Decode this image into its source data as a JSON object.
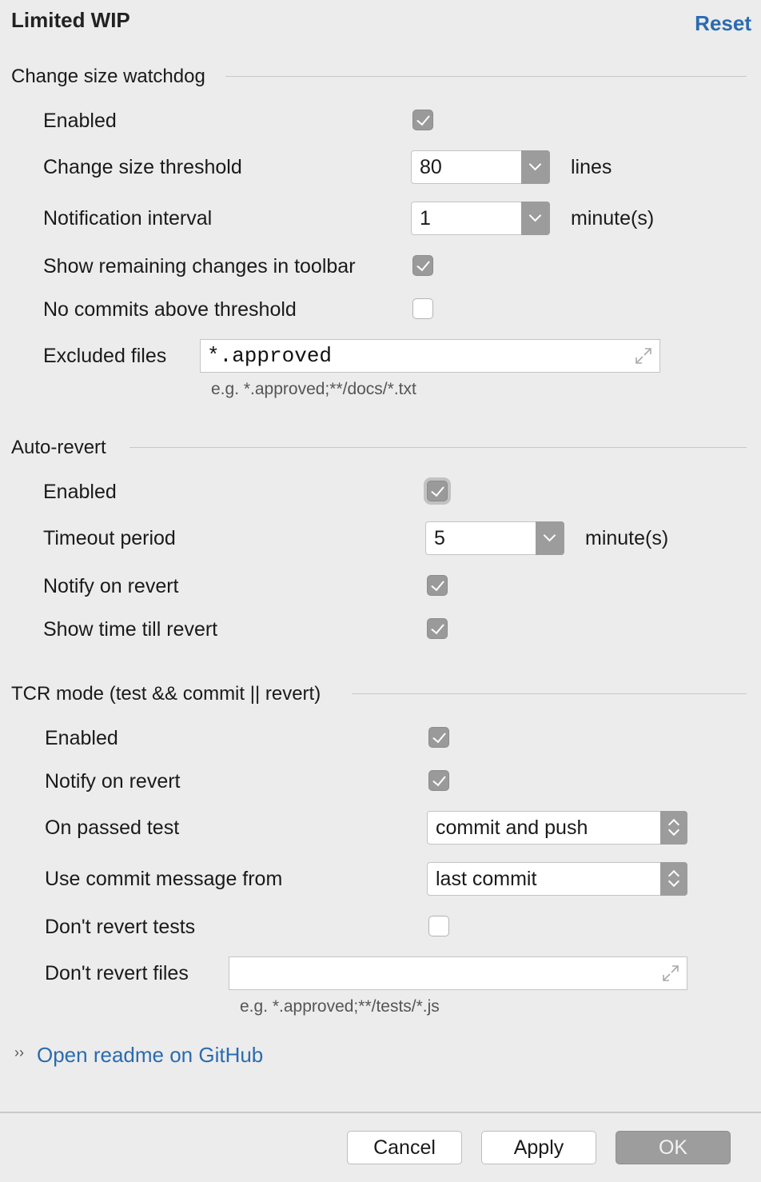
{
  "header": {
    "title": "Limited WIP",
    "reset_label": "Reset"
  },
  "watchdog": {
    "section_title": "Change size watchdog",
    "enabled_label": "Enabled",
    "enabled_checked": true,
    "threshold_label": "Change size threshold",
    "threshold_value": "80",
    "threshold_unit": "lines",
    "interval_label": "Notification interval",
    "interval_value": "1",
    "interval_unit": "minute(s)",
    "show_remaining_label": "Show remaining changes in toolbar",
    "show_remaining_checked": true,
    "no_commits_label": "No commits above threshold",
    "no_commits_checked": false,
    "excluded_label": "Excluded files",
    "excluded_value": "*.approved",
    "excluded_hint": "e.g. *.approved;**/docs/*.txt"
  },
  "autorevert": {
    "section_title": "Auto-revert",
    "enabled_label": "Enabled",
    "enabled_checked": true,
    "timeout_label": "Timeout period",
    "timeout_value": "5",
    "timeout_unit": "minute(s)",
    "notify_label": "Notify on revert",
    "notify_checked": true,
    "show_time_label": "Show time till revert",
    "show_time_checked": true
  },
  "tcr": {
    "section_title": "TCR mode (test && commit || revert)",
    "enabled_label": "Enabled",
    "enabled_checked": true,
    "notify_label": "Notify on revert",
    "notify_checked": true,
    "on_passed_label": "On passed test",
    "on_passed_value": "commit and push",
    "commit_msg_label": "Use commit message from",
    "commit_msg_value": "last commit",
    "dont_revert_tests_label": "Don't revert tests",
    "dont_revert_tests_checked": false,
    "dont_revert_files_label": "Don't revert files",
    "dont_revert_files_value": "",
    "dont_revert_files_hint": "e.g. *.approved;**/tests/*.js"
  },
  "link": {
    "arrows": "››",
    "label": "Open readme on GitHub"
  },
  "footer": {
    "cancel_label": "Cancel",
    "apply_label": "Apply",
    "ok_label": "OK"
  },
  "icons": {
    "checkbox": "checkmark-icon",
    "combo": "chevron-down-icon",
    "select": "up-down-arrows-icon",
    "expand": "expand-icon"
  },
  "colors": {
    "accent": "#2a6bb0",
    "background": "#ececec",
    "checkbox_checked": "#9a9a9a"
  }
}
